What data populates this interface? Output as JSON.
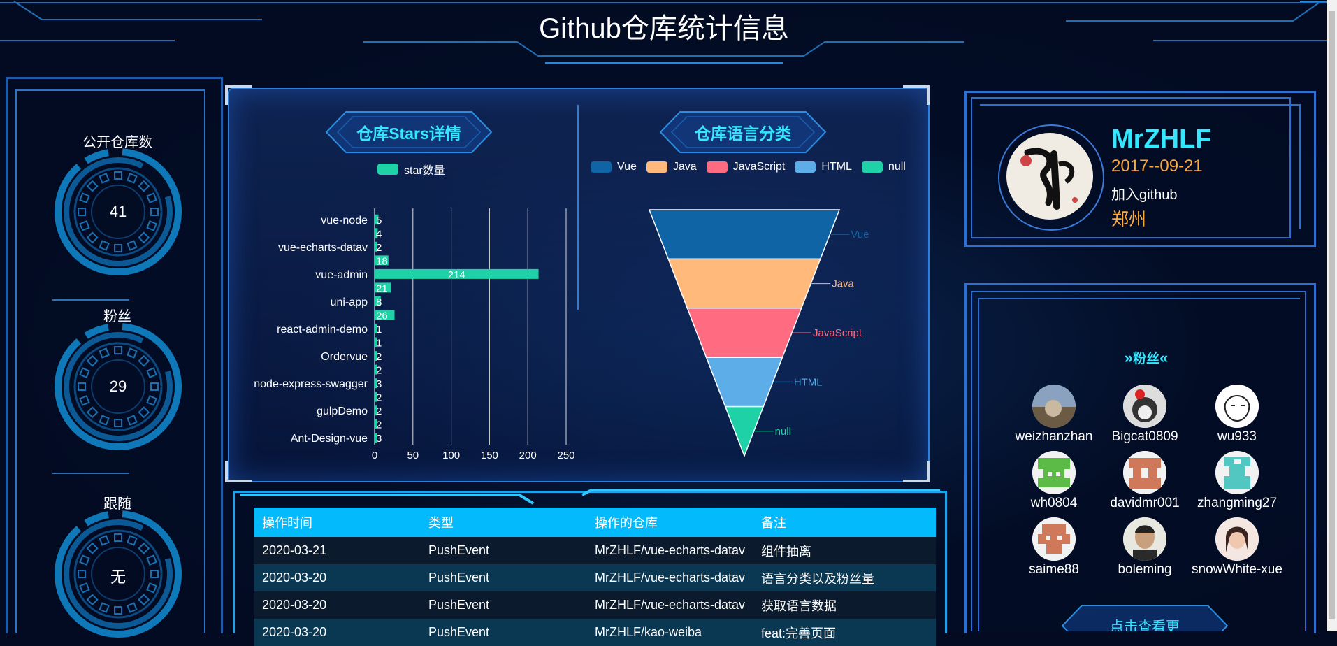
{
  "page": {
    "title": "Github仓库统计信息"
  },
  "stats": [
    {
      "label": "公开仓库数",
      "value": "41"
    },
    {
      "label": "粉丝",
      "value": "29"
    },
    {
      "label": "跟随",
      "value": "无"
    }
  ],
  "stars_panel": {
    "title": "仓库Stars详情",
    "legend": "star数量"
  },
  "lang_panel": {
    "title": "仓库语言分类"
  },
  "chart_data": [
    {
      "type": "bar",
      "title": "仓库Stars详情",
      "orientation": "horizontal",
      "categories": [
        "vue-node",
        "",
        "vue-echarts-datav",
        "",
        "vue-admin",
        "",
        "uni-app",
        "",
        "react-admin-demo",
        "",
        "Ordervue",
        "",
        "node-express-swagger",
        "",
        "gulpDemo",
        "",
        "Ant-Design-vue"
      ],
      "series": [
        {
          "name": "star数量",
          "values": [
            5,
            4,
            2,
            18,
            214,
            21,
            8,
            26,
            1,
            1,
            2,
            2,
            3,
            2,
            2,
            2,
            3
          ],
          "color": "#1fd1a6"
        }
      ],
      "xticks": [
        "0",
        "50",
        "100",
        "150",
        "200",
        "250"
      ],
      "xlim": [
        0,
        250
      ],
      "legend": "top"
    },
    {
      "type": "funnel",
      "title": "仓库语言分类",
      "categories": [
        "Vue",
        "Java",
        "JavaScript",
        "HTML",
        "null"
      ],
      "colors": [
        "#0e64a4",
        "#ffb97a",
        "#ff6b81",
        "#5dade8",
        "#1fd1a6"
      ],
      "legend": "top"
    }
  ],
  "table": {
    "headers": [
      "操作时间",
      "类型",
      "操作的仓库",
      "备注"
    ],
    "rows": [
      [
        "2020-03-21",
        "PushEvent",
        "MrZHLF/vue-echarts-datav",
        "组件抽离"
      ],
      [
        "2020-03-20",
        "PushEvent",
        "MrZHLF/vue-echarts-datav",
        "语言分类以及粉丝量"
      ],
      [
        "2020-03-20",
        "PushEvent",
        "MrZHLF/vue-echarts-datav",
        "获取语言数据"
      ],
      [
        "2020-03-20",
        "PushEvent",
        "MrZHLF/kao-weiba",
        "feat:完善页面"
      ]
    ]
  },
  "profile": {
    "name": "MrZHLF",
    "date": "2017--09-21",
    "joined": "加入github",
    "city": "郑州"
  },
  "followers": {
    "title": "粉丝",
    "button": "点击查看更",
    "items": [
      "weizhanzhan",
      "Bigcat0809",
      "wu933",
      "wh0804",
      "davidmr001",
      "zhangming27",
      "saime88",
      "boleming",
      "snowWhite-xue"
    ]
  },
  "colors": {
    "accent": "#35e6ff",
    "bar": "#1fd1a6",
    "table_header": "#02bafc",
    "orange": "#ffa93b"
  }
}
